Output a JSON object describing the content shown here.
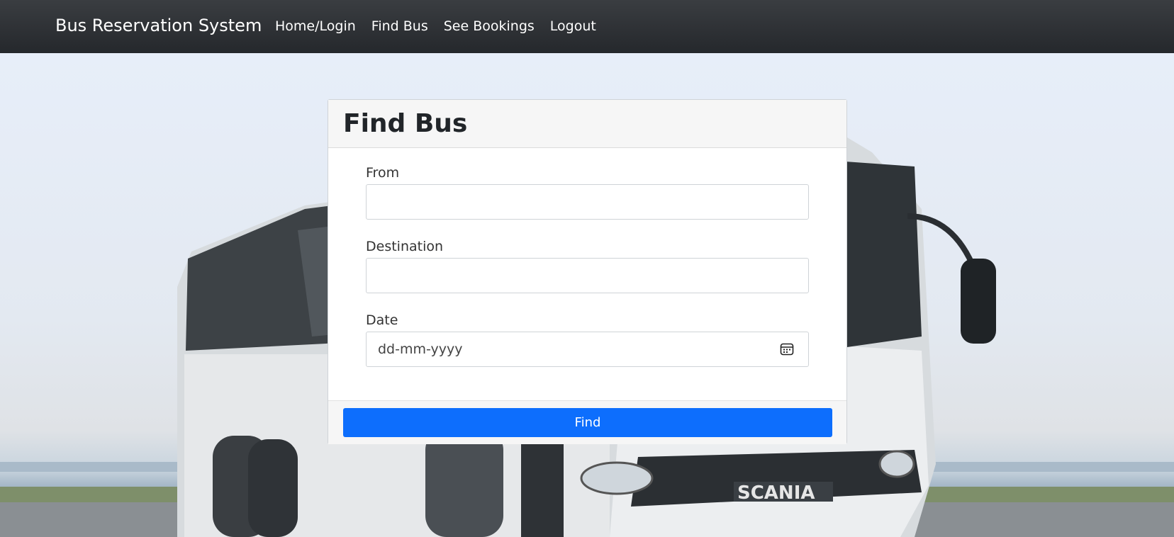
{
  "navbar": {
    "brand": "Bus Reservation System",
    "links": [
      "Home/Login",
      "Find Bus",
      "See Bookings",
      "Logout"
    ]
  },
  "card": {
    "title": "Find Bus",
    "fields": {
      "from_label": "From",
      "from_value": "",
      "destination_label": "Destination",
      "destination_value": "",
      "date_label": "Date",
      "date_placeholder": "dd-mm-yyyy"
    },
    "submit_label": "Find"
  },
  "background": {
    "bus_badge": "SCANIA"
  },
  "colors": {
    "navbar": "#2b2e32",
    "primary": "#0d6efd",
    "card_header": "#f6f6f6"
  },
  "icons": {
    "date_picker": "calendar-icon"
  }
}
